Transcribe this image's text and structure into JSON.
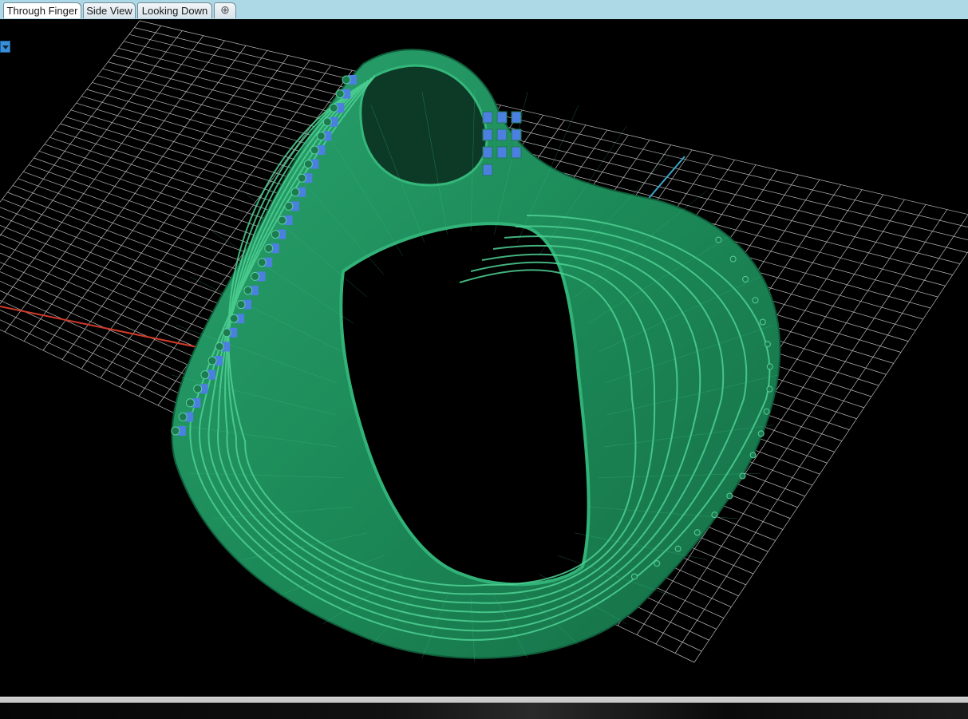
{
  "tabs": [
    {
      "label": "Through Finger",
      "active": true
    },
    {
      "label": "Side View",
      "active": false
    },
    {
      "label": "Looking Down",
      "active": false
    }
  ],
  "add_tab_icon": "plus-icon",
  "view_menu_icon": "chevron-down-icon",
  "colors": {
    "tab_bar": "#add8e6",
    "viewport_background": "#000000",
    "grid": "#d8d8d8",
    "x_axis": "#d23a2a",
    "y_axis": "#3aa7c9",
    "model_body": "#1f8a5c",
    "model_wire": "#3fc285",
    "gem_settings": "#4b7fe0"
  }
}
